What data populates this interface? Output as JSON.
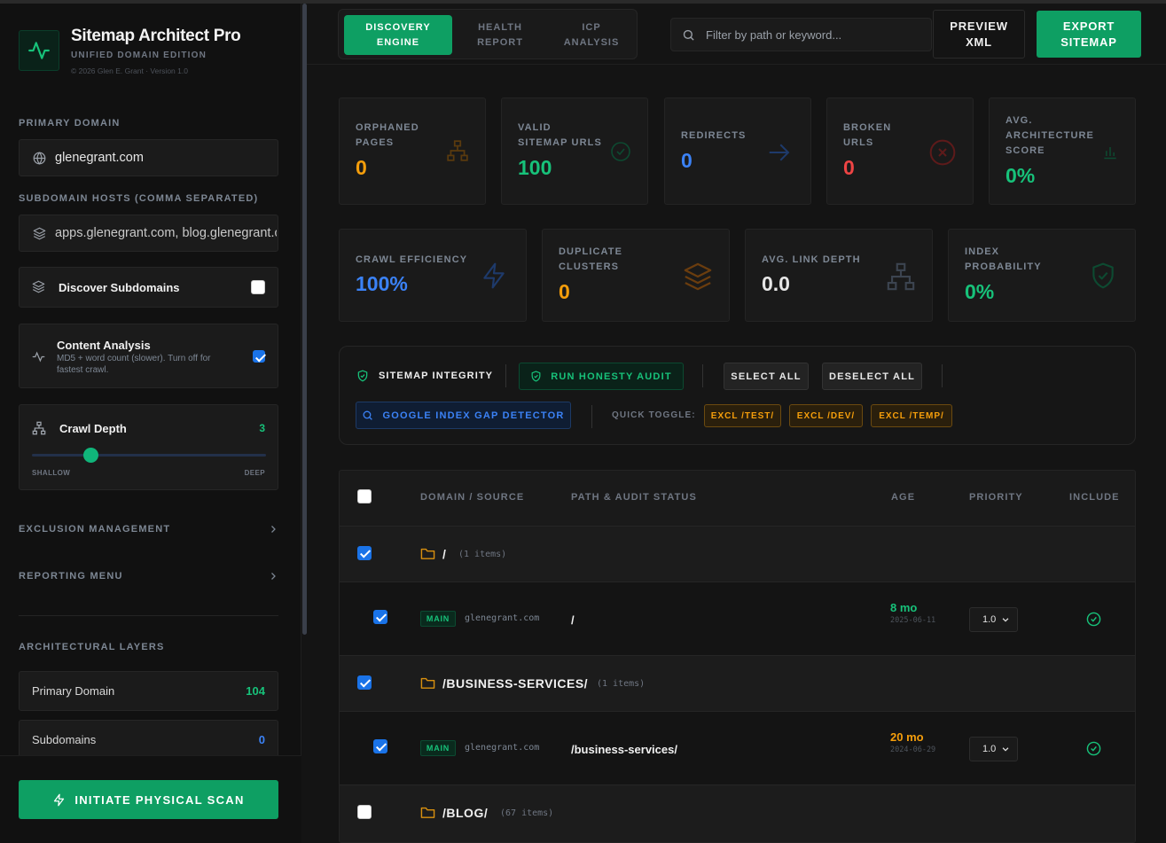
{
  "app": {
    "title": "Sitemap Architect Pro",
    "subtitle": "UNIFIED DOMAIN EDITION",
    "copyright": "© 2026 Glen E. Grant · Version 1.0",
    "logo_icon": "pulse-icon"
  },
  "sidebar": {
    "primary_domain_label": "PRIMARY DOMAIN",
    "primary_domain_value": "glenegrant.com",
    "subdomain_hosts_label": "SUBDOMAIN HOSTS (COMMA SEPARATED)",
    "subdomain_hosts_value": "apps.glenegrant.com, blog.glenegrant.com",
    "discover_subdomains_label": "Discover Subdomains",
    "discover_subdomains_checked": false,
    "content_analysis_label": "Content Analysis",
    "content_analysis_desc": "MD5 + word count (slower). Turn off for fastest crawl.",
    "content_analysis_checked": true,
    "crawl_depth_label": "Crawl Depth",
    "crawl_depth_value": "3",
    "crawl_depth_level": 0.25,
    "crawl_depth_min_label": "SHALLOW",
    "crawl_depth_max_label": "DEEP",
    "exclusion_management_label": "EXCLUSION MANAGEMENT",
    "reporting_menu_label": "REPORTING MENU",
    "architectural_layers_label": "ARCHITECTURAL LAYERS",
    "layers": [
      {
        "label": "Primary Domain",
        "count": "104",
        "color": "#17c27a"
      },
      {
        "label": "Subdomains",
        "count": "0",
        "color": "#3b82f6"
      }
    ],
    "scan_button_label": "INITIATE PHYSICAL SCAN"
  },
  "header": {
    "tabs": [
      {
        "line1": "DISCOVERY",
        "line2": "ENGINE",
        "active": true
      },
      {
        "line1": "HEALTH",
        "line2": "REPORT",
        "active": false
      },
      {
        "line1": "ICP",
        "line2": "ANALYSIS",
        "active": false
      }
    ],
    "search_placeholder": "Filter by path or keyword...",
    "preview_line1": "PREVIEW",
    "preview_line2": "XML",
    "export_line1": "EXPORT",
    "export_line2": "SITEMAP"
  },
  "stats_row1": [
    {
      "l1": "ORPHANED",
      "l2": "PAGES",
      "l3": "",
      "value": "0",
      "color": "#f59e0b",
      "icon": "sitemap-icon"
    },
    {
      "l1": "VALID",
      "l2": "SITEMAP URLS",
      "l3": "",
      "value": "100",
      "color": "#17c27a",
      "icon": "check-circle-icon"
    },
    {
      "l1": "REDIRECTS",
      "l2": "",
      "l3": "",
      "value": "0",
      "color": "#3b82f6",
      "icon": "arrow-right-icon"
    },
    {
      "l1": "BROKEN",
      "l2": "URLS",
      "l3": "",
      "value": "0",
      "color": "#ef4444",
      "icon": "x-circle-icon"
    },
    {
      "l1": "AVG.",
      "l2": "ARCHITECTURE",
      "l3": "SCORE",
      "value": "0%",
      "color": "#17c27a",
      "icon": "bar-chart-icon"
    }
  ],
  "stats_row2": [
    {
      "l1": "CRAWL EFFICIENCY",
      "l2": "",
      "value": "100%",
      "color": "#3b82f6",
      "icon": "lightning-icon"
    },
    {
      "l1": "DUPLICATE",
      "l2": "CLUSTERS",
      "value": "0",
      "color": "#f59e0b",
      "icon": "layers-icon"
    },
    {
      "l1": "AVG. LINK DEPTH",
      "l2": "",
      "value": "0.0",
      "color": "#e6e6e6",
      "icon": "sitemap-icon"
    },
    {
      "l1": "INDEX",
      "l2": "PROBABILITY",
      "value": "0%",
      "color": "#17c27a",
      "icon": "shield-check-icon"
    }
  ],
  "integrity": {
    "title": "SITEMAP INTEGRITY",
    "honesty_audit": "RUN HONESTY AUDIT",
    "select_all": "SELECT ALL",
    "deselect_all": "DESELECT ALL",
    "gap_detector": "GOOGLE INDEX GAP DETECTOR",
    "quick_toggle_label": "QUICK TOGGLE:",
    "quick_toggles": [
      "EXCL /TEST/",
      "EXCL /DEV/",
      "EXCL /TEMP/"
    ]
  },
  "table": {
    "headers": {
      "domain": "DOMAIN / SOURCE",
      "path": "PATH & AUDIT STATUS",
      "age": "AGE",
      "priority": "PRIORITY",
      "include": "INCLUDE"
    },
    "groups": [
      {
        "name": "/",
        "count": "(1 items)",
        "checked": true
      },
      {
        "name": "/BUSINESS-SERVICES/",
        "count": "(1 items)",
        "checked": true
      },
      {
        "name": "/BLOG/",
        "count": "(67 items)",
        "checked": false
      }
    ],
    "items": [
      {
        "badge": "MAIN",
        "domain": "glenegrant.com",
        "path": "/",
        "age": "8 mo",
        "age_color": "#17c27a",
        "date": "2025-06-11",
        "priority": "1.0",
        "checked": true
      },
      {
        "badge": "MAIN",
        "domain": "glenegrant.com",
        "path": "/business-services/",
        "age": "20 mo",
        "age_color": "#f59e0b",
        "date": "2024-06-29",
        "priority": "1.0",
        "checked": true
      }
    ]
  }
}
